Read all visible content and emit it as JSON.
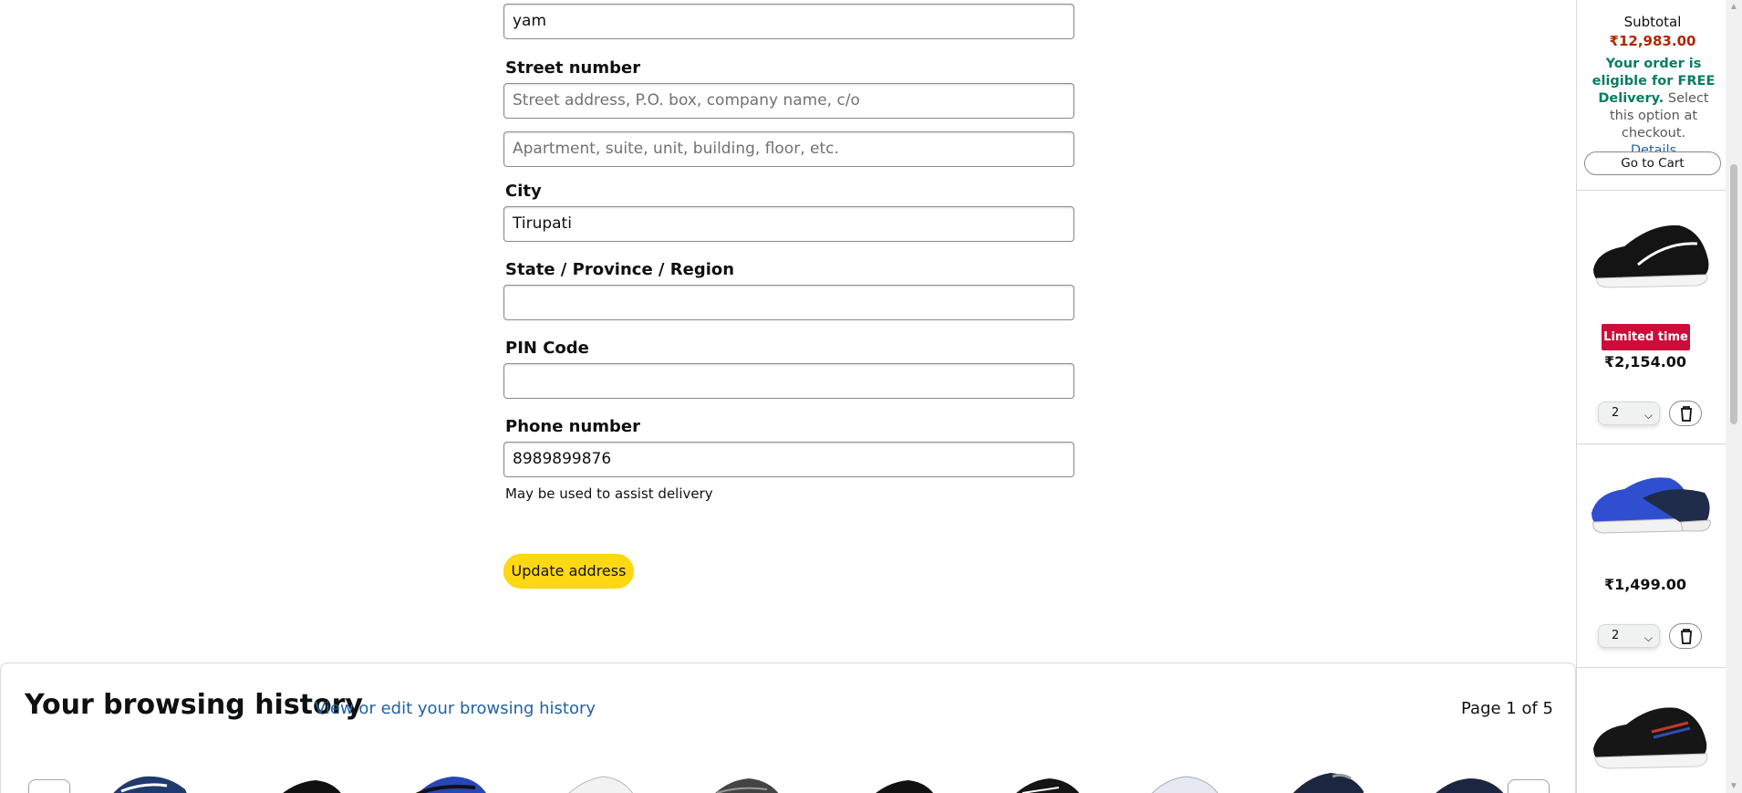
{
  "form": {
    "name_value": "yam",
    "street_label": "Street number",
    "street_line1_placeholder": "Street address, P.O. box, company name, c/o",
    "street_line2_placeholder": "Apartment, suite, unit, building, floor, etc.",
    "city_label": "City",
    "city_value": "Tirupati",
    "state_label": "State / Province / Region",
    "state_value": "",
    "pin_label": "PIN Code",
    "pin_value": "",
    "phone_label": "Phone number",
    "phone_value": "8989899876",
    "phone_hint": "May be used to assist delivery",
    "update_button": "Update address"
  },
  "history": {
    "title": "Your browsing history",
    "link": "View or edit your browsing history",
    "page": "Page 1 of 5"
  },
  "cart": {
    "subtotal_label": "Subtotal",
    "subtotal_amount": "₹12,983.00",
    "free_delivery_bold": "Your order is eligible for FREE Delivery.",
    "free_delivery_rest": " Select this option at checkout.",
    "details_link": "Details",
    "go_to_cart": "Go to Cart",
    "items": [
      {
        "badge": "Limited time",
        "price": "₹2,154.00",
        "qty": "2"
      },
      {
        "price": "₹1,499.00",
        "qty": "2"
      }
    ]
  },
  "colors": {
    "accent_button": "#ffd814",
    "price_red": "#b12704",
    "link_blue": "#2162a1",
    "free_delivery_green": "#067d62",
    "badge_red": "#cc0c39"
  }
}
